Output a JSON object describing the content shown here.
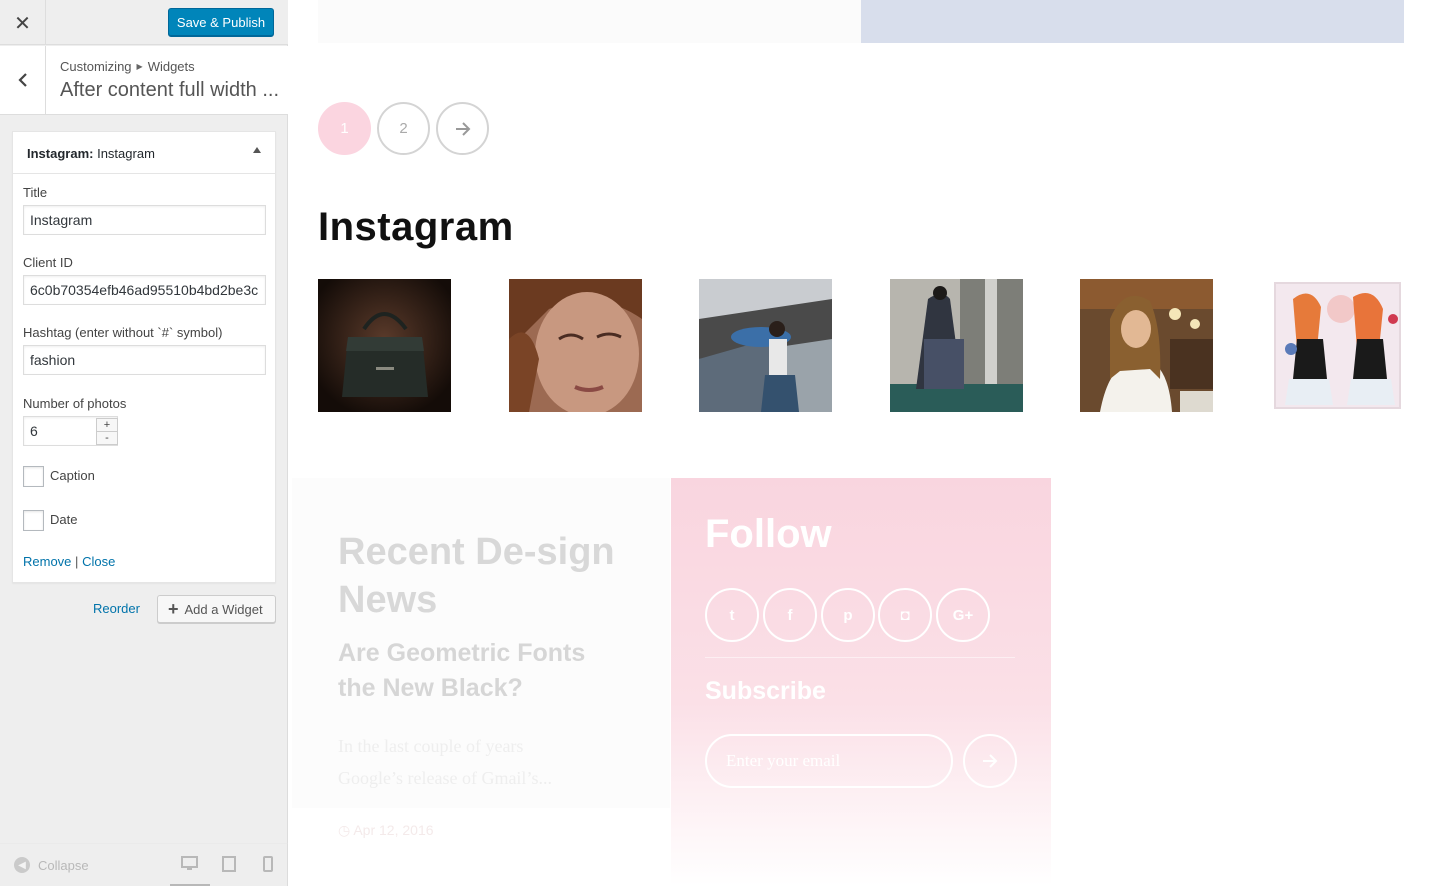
{
  "header": {
    "close_icon": "close-icon",
    "publish_label": "Save & Publish"
  },
  "section": {
    "back_icon": "chevron-left-icon",
    "breadcrumb_parent": "Customizing",
    "breadcrumb_child": "Widgets",
    "title": "After content full width ..."
  },
  "widget": {
    "type_label": "Instagram:",
    "name": "Instagram",
    "fields": {
      "title_label": "Title",
      "title_value": "Instagram",
      "client_label": "Client ID",
      "client_value": "6c0b70354efb46ad95510b4bd2be3c",
      "hashtag_label": "Hashtag (enter without `#` symbol)",
      "hashtag_value": "fashion",
      "photos_label": "Number of photos",
      "photos_value": "6",
      "caption_label": "Caption",
      "date_label": "Date"
    },
    "remove_label": "Remove",
    "separator": "|",
    "close_label": "Close"
  },
  "actions": {
    "reorder_label": "Reorder",
    "add_widget_label": "Add a Widget"
  },
  "footer": {
    "collapse_label": "Collapse",
    "devices": [
      "desktop-icon",
      "tablet-icon",
      "mobile-icon"
    ]
  },
  "preview": {
    "pagination": {
      "pages": [
        "1",
        "2"
      ],
      "next_icon": "arrow-right-icon",
      "current": "1"
    },
    "instagram_title": "Instagram",
    "photos": [
      "handbag-photo",
      "woman-closeup-photo",
      "dancer-photo",
      "dress-photo",
      "cafe-woman-photo",
      "illustration-photo"
    ],
    "recent": {
      "title": "Recent De-sign News",
      "post_title": "Are Geometric Fonts the New Black?",
      "excerpt_line1": "In the last couple of years",
      "excerpt_line2": "Google’s release of Gmail’s...",
      "date": "Apr 12, 2016"
    },
    "follow": {
      "title": "Follow",
      "social": [
        "t",
        "f",
        "p",
        "◘",
        "G+"
      ],
      "subscribe_title": "Subscribe",
      "email_placeholder": "Enter your email",
      "submit_icon": "arrow-right-icon"
    }
  },
  "colors": {
    "accent": "#0085ba",
    "link": "#0073aa",
    "pink": "#f9d5df",
    "band": "#d8deec"
  }
}
